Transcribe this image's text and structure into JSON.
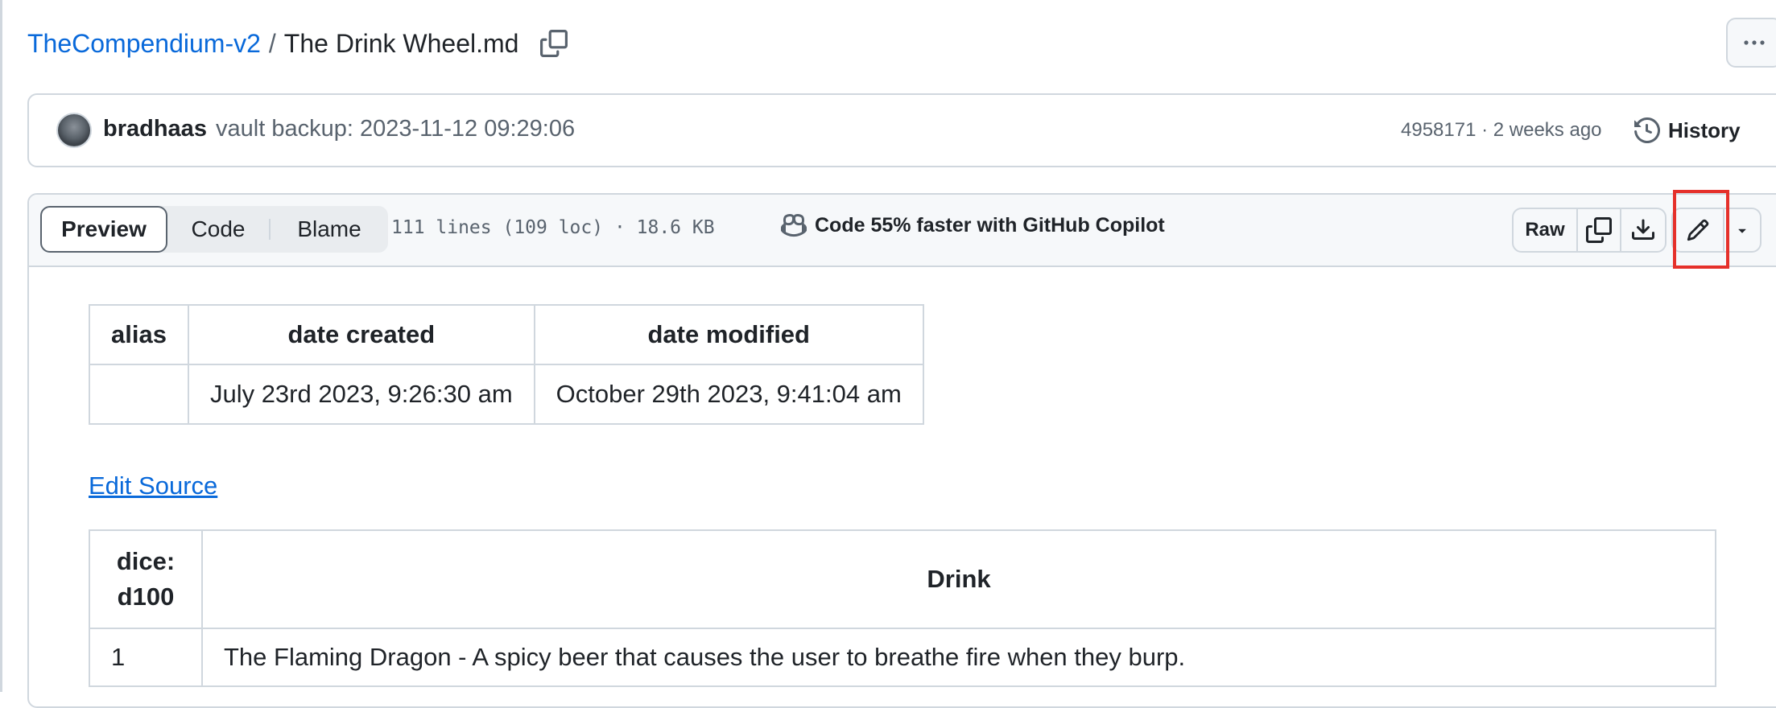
{
  "breadcrumb": {
    "repo": "TheCompendium-v2",
    "separator": "/",
    "file": "The Drink Wheel.md"
  },
  "commit": {
    "author": "bradhaas",
    "message": "vault backup: 2023-11-12 09:29:06",
    "meta": "4958171 · 2 weeks ago",
    "history_label": "History"
  },
  "file_header": {
    "tabs": [
      {
        "label": "Preview",
        "selected": true
      },
      {
        "label": "Code",
        "selected": false
      },
      {
        "label": "Blame",
        "selected": false
      }
    ],
    "stats": "111 lines (109 loc) · 18.6 KB",
    "copilot_label": "Code 55% faster with GitHub Copilot",
    "raw_label": "Raw"
  },
  "meta_table": {
    "headers": [
      "alias",
      "date created",
      "date modified"
    ],
    "row": [
      "",
      "July 23rd 2023, 9:26:30 am",
      "October 29th 2023, 9:41:04 am"
    ]
  },
  "edit_source_label": "Edit Source",
  "drink_table": {
    "headers": [
      "dice: d100",
      "Drink"
    ],
    "rows": [
      [
        "1",
        "The Flaming Dragon - A spicy beer that causes the user to breathe fire when they burp."
      ]
    ]
  },
  "colors": {
    "link": "#0969da",
    "border": "#d0d7de",
    "highlight": "#e5302a"
  }
}
